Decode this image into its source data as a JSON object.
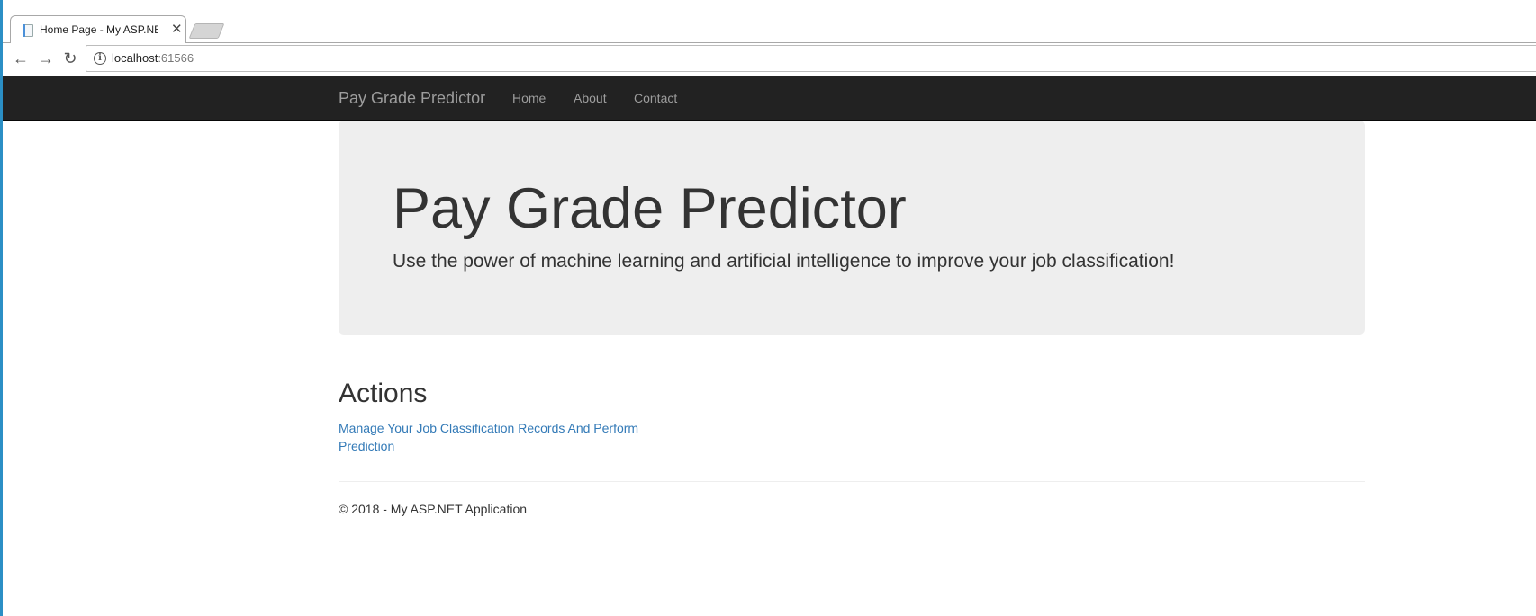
{
  "browser": {
    "tab_title": "Home Page - My ASP.NE",
    "url_host": "localhost",
    "url_port": ":61566"
  },
  "navbar": {
    "brand": "Pay Grade Predictor",
    "links": [
      "Home",
      "About",
      "Contact"
    ]
  },
  "jumbotron": {
    "title": "Pay Grade Predictor",
    "lead": "Use the power of machine learning and artificial intelligence to improve your job classification!"
  },
  "actions": {
    "heading": "Actions",
    "link_label": "Manage Your Job Classification Records And Perform Prediction"
  },
  "footer": {
    "text": "© 2018 - My ASP.NET Application"
  },
  "colors": {
    "navbar_bg": "#222222",
    "nav_text": "#9d9d9d",
    "jumbotron_bg": "#eeeeee",
    "link": "#337ab7"
  }
}
